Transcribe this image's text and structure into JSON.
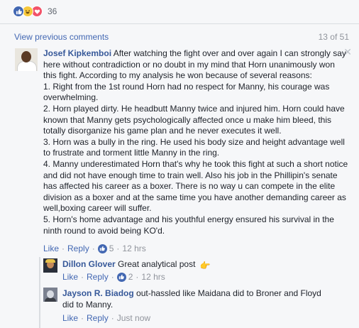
{
  "reactions": {
    "count": "36",
    "icons": [
      "like-icon",
      "haha-icon",
      "love-icon"
    ],
    "colors": {
      "like": "#4267b2",
      "haha": "#f7c83b",
      "love": "#f25268"
    }
  },
  "comments_header": {
    "view_previous": "View previous comments",
    "pager": "13 of 51"
  },
  "main_comment": {
    "author": "Josef Kipkemboi",
    "intro": "After watching the fight over and over again I can strongly say here without contradiction or no doubt in my mind that Horn unanimously won this fight. According to my analysis he won because of several reasons:",
    "points": [
      "1. Right from the 1st round Horn had no respect for Manny, his courage was overwhelming.",
      "2. Horn played dirty. He headbutt Manny twice and injured him. Horn could have known that Manny gets psychologically affected once u make him bleed, this totally disorganize his game plan and he never executes it well.",
      "3. Horn was a bully in the ring. He used his body size and height advantage well to frustrate and torment little Manny in the ring.",
      "4. Manny underestimated Horn that's why he took this fight at such a short notice and did not have enough time to train well. Also his job in the Phillipin's senate has affected his career as a boxer. There is no way u can compete in the elite division as a boxer and at the same time you have another demanding career as well,boxing career will suffer.",
      "5. Horn's home advantage and his youthful energy ensured his survival in the ninth round to avoid being KO'd."
    ],
    "like_label": "Like",
    "reply_label": "Reply",
    "like_count": "5",
    "time": "12 hrs"
  },
  "replies": [
    {
      "author": "Dillon Glover",
      "text": "Great analytical post",
      "emoji": "👉",
      "like_label": "Like",
      "reply_label": "Reply",
      "like_count": "2",
      "time": "12 hrs"
    },
    {
      "author": "Jayson R. Biadog",
      "text": "out-hassled like Maidana did to Broner and Floyd did to Manny.",
      "like_label": "Like",
      "reply_label": "Reply",
      "time": "Just now"
    }
  ],
  "close_label": "✕"
}
